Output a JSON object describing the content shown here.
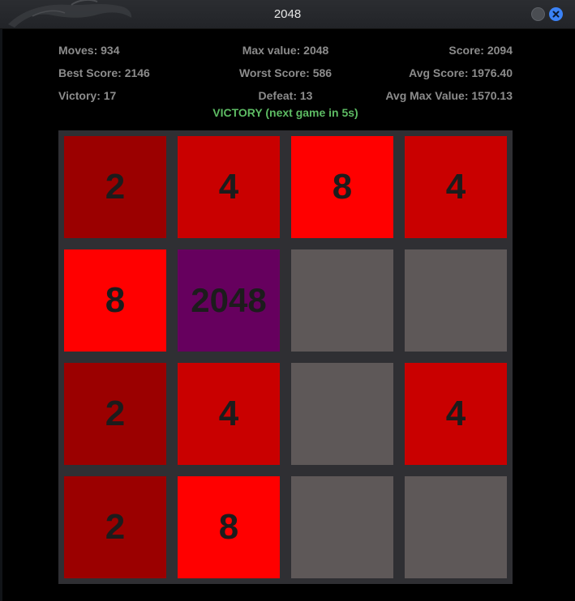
{
  "window": {
    "title": "2048"
  },
  "stats": {
    "moves": "Moves: 934",
    "max_value": "Max value: 2048",
    "score": "Score: 2094",
    "best_score": "Best Score: 2146",
    "worst_score": "Worst Score: 586",
    "avg_score": "Avg Score: 1976.40",
    "victory": "Victory: 17",
    "defeat": "Defeat: 13",
    "avg_max_value": "Avg Max Value: 1570.13"
  },
  "status": "VICTORY (next game in 5s)",
  "colors": {
    "tile_2": "#9b0000",
    "tile_4": "#c90000",
    "tile_8": "#ff0000",
    "tile_2048": "#66005e",
    "tile_empty": "#5e5858",
    "board": "#2f2f33",
    "status_green": "#5dbb63"
  },
  "board": [
    [
      "2",
      "4",
      "8",
      "4"
    ],
    [
      "8",
      "2048",
      "",
      ""
    ],
    [
      "2",
      "4",
      "",
      "4"
    ],
    [
      "2",
      "8",
      "",
      ""
    ]
  ]
}
